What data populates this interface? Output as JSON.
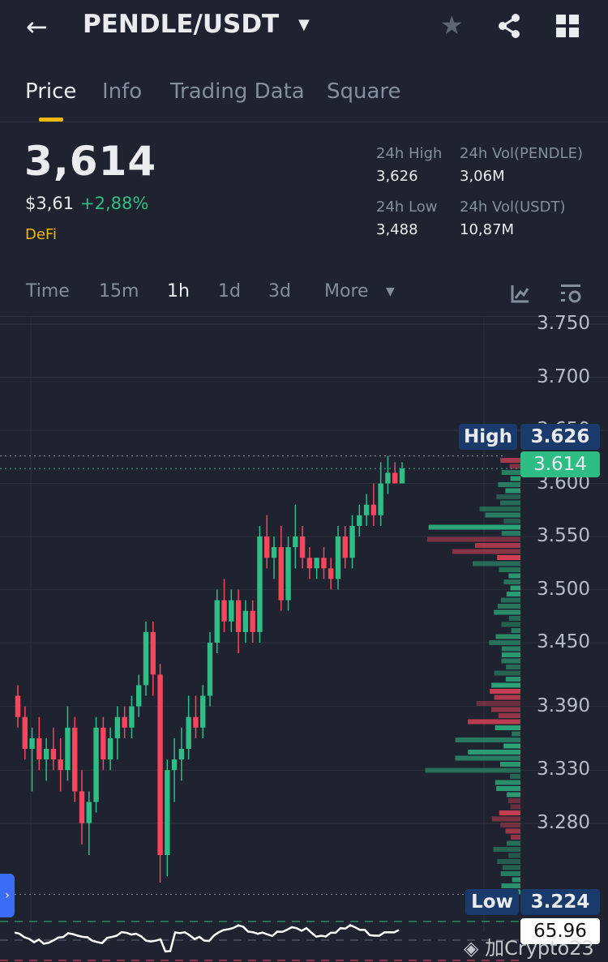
{
  "header": {
    "pair": "PENDLE/USDT"
  },
  "tabs": [
    "Price",
    "Info",
    "Trading Data",
    "Square"
  ],
  "price": {
    "last": "3,614",
    "usd": "$3,61",
    "change": "+2,88%",
    "tag": "DeFi"
  },
  "stats": {
    "high_label": "24h High",
    "high": "3,626",
    "vol_base_label": "24h Vol(PENDLE)",
    "vol_base": "3,06M",
    "low_label": "24h Low",
    "low": "3,488",
    "vol_quote_label": "24h Vol(USDT)",
    "vol_quote": "10,87M"
  },
  "timeframes": [
    "Time",
    "15m",
    "1h",
    "1d",
    "3d",
    "More"
  ],
  "markers": {
    "high_label": "High",
    "high": "3.626",
    "current": "3.614",
    "low_label": "Low",
    "low": "3.224",
    "rsi": "65.96"
  },
  "watermark": "加Crypto23",
  "colors": {
    "up": "#2ebd85",
    "down": "#f6465d",
    "accent": "#f0b90b"
  },
  "chart_data": {
    "type": "candlestick",
    "interval": "1h",
    "y_ticks": [
      "3.750",
      "3.700",
      "3.650",
      "3.600",
      "3.550",
      "3.500",
      "3.450",
      "3.390",
      "3.330",
      "3.280"
    ],
    "ylim": [
      3.21,
      3.76
    ],
    "ohlc": [
      [
        3.4,
        3.41,
        3.37,
        3.38
      ],
      [
        3.38,
        3.39,
        3.34,
        3.35
      ],
      [
        3.35,
        3.37,
        3.31,
        3.36
      ],
      [
        3.36,
        3.38,
        3.33,
        3.34
      ],
      [
        3.34,
        3.36,
        3.32,
        3.35
      ],
      [
        3.35,
        3.37,
        3.33,
        3.34
      ],
      [
        3.34,
        3.36,
        3.31,
        3.33
      ],
      [
        3.33,
        3.39,
        3.32,
        3.37
      ],
      [
        3.37,
        3.38,
        3.3,
        3.31
      ],
      [
        3.31,
        3.33,
        3.26,
        3.28
      ],
      [
        3.28,
        3.31,
        3.25,
        3.3
      ],
      [
        3.3,
        3.38,
        3.29,
        3.37
      ],
      [
        3.37,
        3.38,
        3.33,
        3.34
      ],
      [
        3.34,
        3.37,
        3.33,
        3.36
      ],
      [
        3.36,
        3.39,
        3.34,
        3.38
      ],
      [
        3.38,
        3.39,
        3.36,
        3.37
      ],
      [
        3.37,
        3.4,
        3.36,
        3.39
      ],
      [
        3.39,
        3.42,
        3.38,
        3.41
      ],
      [
        3.41,
        3.47,
        3.4,
        3.46
      ],
      [
        3.46,
        3.47,
        3.4,
        3.42
      ],
      [
        3.42,
        3.43,
        3.224,
        3.25
      ],
      [
        3.25,
        3.34,
        3.23,
        3.33
      ],
      [
        3.33,
        3.36,
        3.3,
        3.34
      ],
      [
        3.34,
        3.37,
        3.32,
        3.35
      ],
      [
        3.35,
        3.4,
        3.34,
        3.38
      ],
      [
        3.38,
        3.4,
        3.36,
        3.37
      ],
      [
        3.37,
        3.41,
        3.36,
        3.4
      ],
      [
        3.4,
        3.46,
        3.39,
        3.45
      ],
      [
        3.45,
        3.5,
        3.44,
        3.49
      ],
      [
        3.49,
        3.51,
        3.46,
        3.47
      ],
      [
        3.47,
        3.5,
        3.46,
        3.49
      ],
      [
        3.49,
        3.5,
        3.44,
        3.46
      ],
      [
        3.46,
        3.49,
        3.45,
        3.48
      ],
      [
        3.48,
        3.49,
        3.45,
        3.46
      ],
      [
        3.46,
        3.56,
        3.45,
        3.55
      ],
      [
        3.55,
        3.57,
        3.52,
        3.53
      ],
      [
        3.53,
        3.55,
        3.51,
        3.54
      ],
      [
        3.54,
        3.56,
        3.48,
        3.49
      ],
      [
        3.49,
        3.55,
        3.48,
        3.54
      ],
      [
        3.54,
        3.58,
        3.52,
        3.55
      ],
      [
        3.55,
        3.56,
        3.52,
        3.53
      ],
      [
        3.53,
        3.54,
        3.51,
        3.52
      ],
      [
        3.52,
        3.53,
        3.51,
        3.53
      ],
      [
        3.53,
        3.54,
        3.51,
        3.52
      ],
      [
        3.52,
        3.53,
        3.5,
        3.51
      ],
      [
        3.51,
        3.56,
        3.5,
        3.55
      ],
      [
        3.55,
        3.56,
        3.52,
        3.53
      ],
      [
        3.53,
        3.57,
        3.52,
        3.56
      ],
      [
        3.56,
        3.58,
        3.55,
        3.57
      ],
      [
        3.57,
        3.59,
        3.56,
        3.58
      ],
      [
        3.58,
        3.6,
        3.56,
        3.57
      ],
      [
        3.57,
        3.62,
        3.56,
        3.6
      ],
      [
        3.6,
        3.626,
        3.59,
        3.61
      ],
      [
        3.61,
        3.62,
        3.6,
        3.6
      ],
      [
        3.6,
        3.62,
        3.6,
        3.614
      ]
    ]
  }
}
